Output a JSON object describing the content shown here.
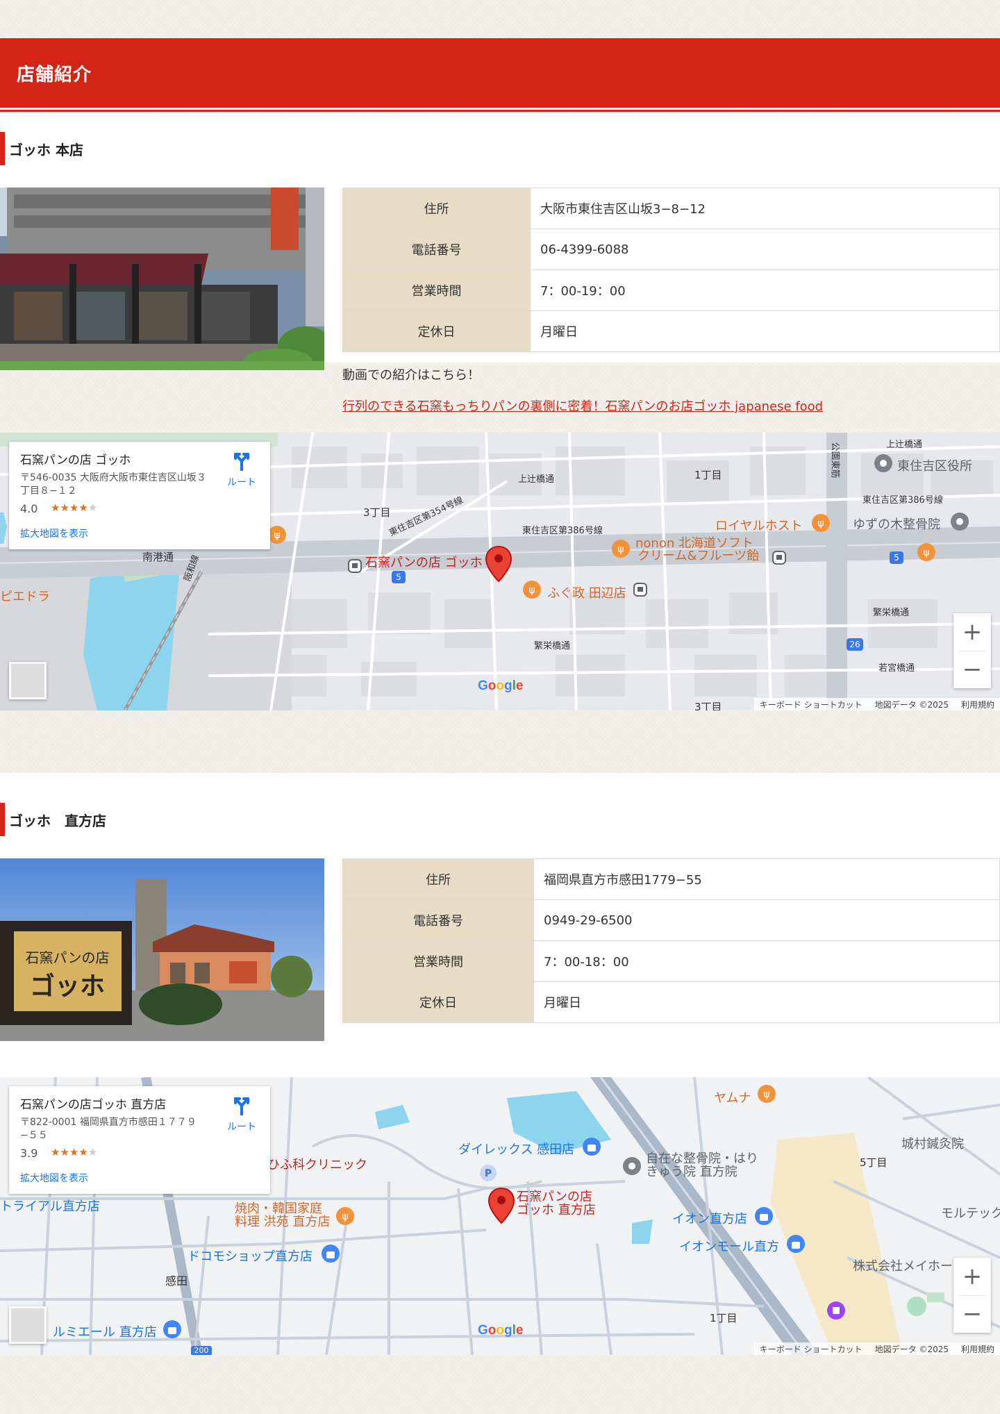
{
  "header": {
    "title": "店舗紹介"
  },
  "stores": [
    {
      "name": "ゴッホ 本店",
      "table": [
        {
          "label": "住所",
          "value": "大阪市東住吉区山坂3−8−12"
        },
        {
          "label": "電話番号",
          "value": "06-4399-6088"
        },
        {
          "label": "営業時間",
          "value": "7：00-19：00"
        },
        {
          "label": "定休日",
          "value": "月曜日"
        }
      ],
      "video_intro": "動画での紹介はこちら！",
      "video_link": "行列のできる石窯もっちりパンの裏側に密着！石窯パンのお店ゴッホ japanese food",
      "map": {
        "place_name": "石窯パンの店 ゴッホ",
        "address": "〒546-0035 大阪府大阪市東住吉区山坂３丁目８−１２",
        "rating": "4.0",
        "stars_full": 4,
        "route_label": "ルート",
        "larger_map": "拡大地図を表示",
        "labels": {
          "pin": "石窯パンの店 ゴッホ",
          "higashisumiyoshi": "東住吉区役所",
          "royal_host": "ロイヤルホスト",
          "yuzunoki": "ゆずの木整骨院",
          "nonon_1": "nonon 北海道ソフト",
          "nonon_2": "クリーム&フルーツ飴",
          "fukumasa": "ふぐ政 田辺店",
          "piedora": "ピエドラ",
          "nanko": "南港通",
          "hanwa": "阪和線",
          "route354": "東住吉区第354号線",
          "route386a": "東住吉区第386号線",
          "route386b": "東住吉区第386号線",
          "kamitsuji1": "上辻橋通",
          "kamitsuji2": "上辻橋通",
          "koenhigashi": "公園東筋",
          "hanei1": "繁栄橋通",
          "hanei2": "繁栄橋通",
          "wakamiya": "若宮橋通",
          "chome1": "1丁目",
          "chome3a": "3丁目",
          "chome3b": "3丁目",
          "road5a": "5",
          "road5b": "5",
          "road26": "26"
        },
        "attrib": {
          "shortcuts": "キーボード ショートカット",
          "data": "地図データ ©2025",
          "terms": "利用規約"
        },
        "google": "Google",
        "zoom_in": "+",
        "zoom_out": "−"
      }
    },
    {
      "name": "ゴッホ　直方店",
      "table": [
        {
          "label": "住所",
          "value": "福岡県直方市感田1779−55"
        },
        {
          "label": "電話番号",
          "value": "0949-29-6500"
        },
        {
          "label": "営業時間",
          "value": "7：00-18：00"
        },
        {
          "label": "定休日",
          "value": "月曜日"
        }
      ],
      "map": {
        "place_name": "石窯パンの店ゴッホ 直方店",
        "address": "〒822-0001 福岡県直方市感田１７７９−５５",
        "rating": "3.9",
        "stars_full": 4,
        "route_label": "ルート",
        "larger_map": "拡大地図を表示",
        "labels": {
          "pin_1": "石窯パンの店",
          "pin_2": "ゴッホ 直方店",
          "yamuna": "ヤムナ",
          "dailex": "ダイレックス 感田店",
          "jizai_1": "自在な整骨院・はり",
          "jizai_2": "きゅう院 直方院",
          "jomura": "城村鍼灸院",
          "chome5": "5丁目",
          "aeon": "イオン直方店",
          "aeonmall": "イオンモール直方",
          "meiho": "株式会社メイホー",
          "morute": "モルテック",
          "yakiniku_1": "焼肉・韓国家庭",
          "yakiniku_2": "料理 洪苑 直方店",
          "clinic": "ひふ科クリニック",
          "trial": "トライアル直方店",
          "docomo": "ドコモショップ直方店",
          "kanda": "感田",
          "lumiere": "ルミエール 直方店",
          "chome1": "1丁目",
          "road200": "200",
          "parking": "P"
        },
        "attrib": {
          "shortcuts": "キーボード ショートカット",
          "data": "地図データ ©2025",
          "terms": "利用規約"
        },
        "google": "Google",
        "zoom_in": "+",
        "zoom_out": "−"
      }
    }
  ],
  "colors": {
    "brand_red": "#d32415",
    "label_bg": "#e8dcc7",
    "map_blue": "#1a73e8",
    "star_orange": "#e7711b"
  },
  "icons": [
    "marker-pin-icon",
    "directions-icon",
    "zoom-in-icon",
    "zoom-out-icon",
    "pegman-icon",
    "restaurant-icon",
    "shopping-icon",
    "bus-stop-icon",
    "parking-icon"
  ]
}
